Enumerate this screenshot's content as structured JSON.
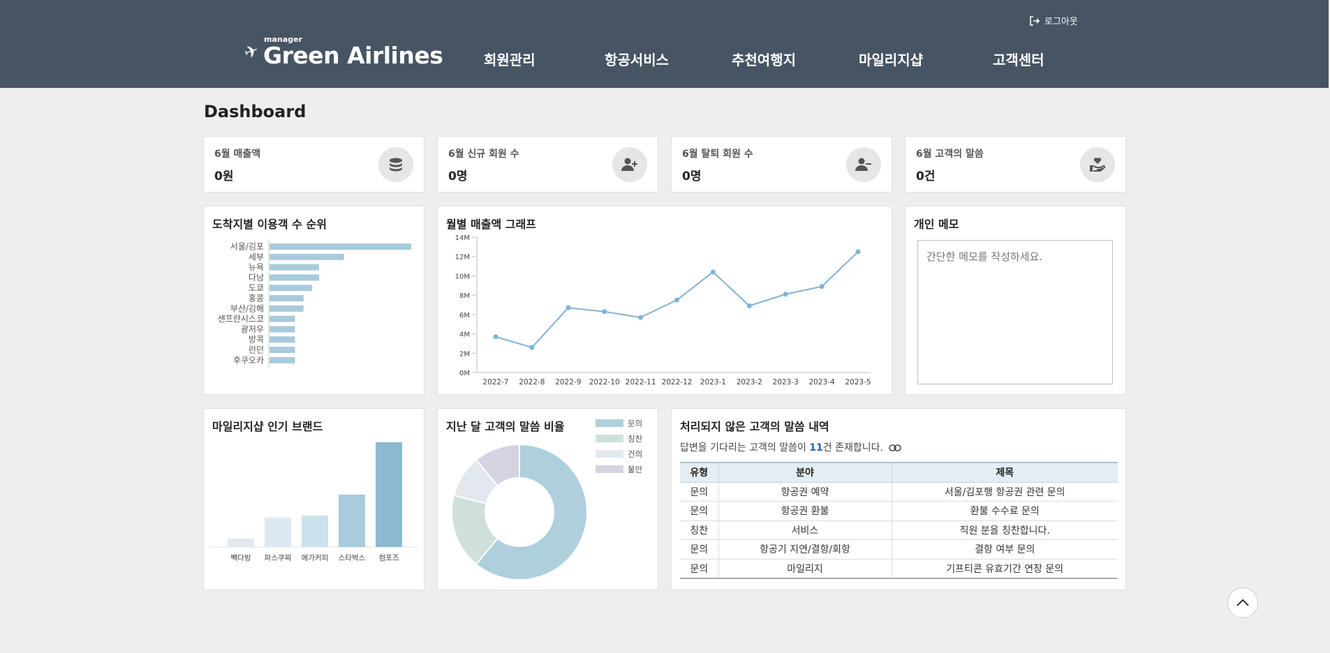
{
  "header": {
    "logout_label": "로그아웃",
    "logo_small": "manager",
    "logo_text": "Green Airlines",
    "nav": [
      "회원관리",
      "항공서비스",
      "추천여행지",
      "마일리지샵",
      "고객센터"
    ]
  },
  "dashboard_title": "Dashboard",
  "stats": [
    {
      "label": "6월 매출액",
      "value": "0원",
      "icon": "database-coins-icon"
    },
    {
      "label": "6월 신규 회원 수",
      "value": "0명",
      "icon": "user-plus-icon"
    },
    {
      "label": "6월 탈퇴 회원 수",
      "value": "0명",
      "icon": "user-minus-icon"
    },
    {
      "label": "6월 고객의 말씀",
      "value": "0건",
      "icon": "hand-heart-icon"
    }
  ],
  "panels": {
    "destinations_title": "도착지별 이용객 수 순위",
    "revenue_title": "월별 매출액 그래프",
    "memo_title": "개인 메모",
    "memo_placeholder": "간단한 메모를 작성하세요.",
    "brands_title": "마일리지샵 인기 브랜드",
    "ratio_title": "지난 달 고객의 말씀 비율",
    "inquiries_title": "처리되지 않은 고객의 말씀 내역"
  },
  "inquiries": {
    "desc_before": "답변을 기다리는 고객의 말씀이 ",
    "count": "11",
    "desc_after": "건 존재합니다.",
    "columns": [
      "유형",
      "분야",
      "제목"
    ],
    "rows": [
      [
        "문의",
        "항공권 예약",
        "서울/김포행 항공권 관련 문의"
      ],
      [
        "문의",
        "항공권 환불",
        "환불 수수료 문의"
      ],
      [
        "칭찬",
        "서비스",
        "직원 분을 칭찬합니다."
      ],
      [
        "문의",
        "항공기 지연/결항/회항",
        "결항 여부 문의"
      ],
      [
        "문의",
        "마일리지",
        "기프티콘 유효기간 연장 문의"
      ]
    ]
  },
  "chart_data": [
    {
      "type": "bar",
      "orientation": "horizontal",
      "title": "도착지별 이용객 수 순위",
      "categories": [
        "서울/김포",
        "세부",
        "뉴욕",
        "다낭",
        "도쿄",
        "홍콩",
        "부산/김해",
        "샌프란시스코",
        "광저우",
        "방콕",
        "런던",
        "후쿠오카"
      ],
      "values": [
        20,
        10.5,
        7,
        7,
        6,
        4.8,
        4.8,
        3.6,
        3.6,
        3.6,
        3.6,
        3.6
      ],
      "color": "#a8cadc"
    },
    {
      "type": "line",
      "title": "월별 매출액 그래프",
      "x": [
        "2022-7",
        "2022-8",
        "2022-9",
        "2022-10",
        "2022-11",
        "2022-12",
        "2023-1",
        "2023-2",
        "2023-3",
        "2023-4",
        "2023-5"
      ],
      "values": [
        3.7,
        2.6,
        6.7,
        6.3,
        5.7,
        7.5,
        10.4,
        6.9,
        8.1,
        8.9,
        12.5
      ],
      "yticks": [
        "0M",
        "2M",
        "4M",
        "6M",
        "8M",
        "10M",
        "12M",
        "14M"
      ],
      "ylim": [
        0,
        14
      ],
      "color": "#7fb3d9"
    },
    {
      "type": "bar",
      "title": "마일리지샵 인기 브랜드",
      "categories": [
        "빽다방",
        "파스쿠찌",
        "메가커피",
        "스타벅스",
        "컴포즈"
      ],
      "values": [
        8,
        28,
        30,
        50,
        100
      ],
      "colors": [
        "#e3e8ec",
        "#dde9f2",
        "#cce2ec",
        "#a9cbdc",
        "#8dbad0"
      ]
    },
    {
      "type": "pie",
      "title": "지난 달 고객의 말씀 비율",
      "labels": [
        "문의",
        "칭찬",
        "건의",
        "불만"
      ],
      "values": [
        61,
        18,
        10,
        11
      ],
      "colors": [
        "#afcfdd",
        "#cfe0dc",
        "#e2e8ed",
        "#d5d3e2"
      ]
    }
  ]
}
